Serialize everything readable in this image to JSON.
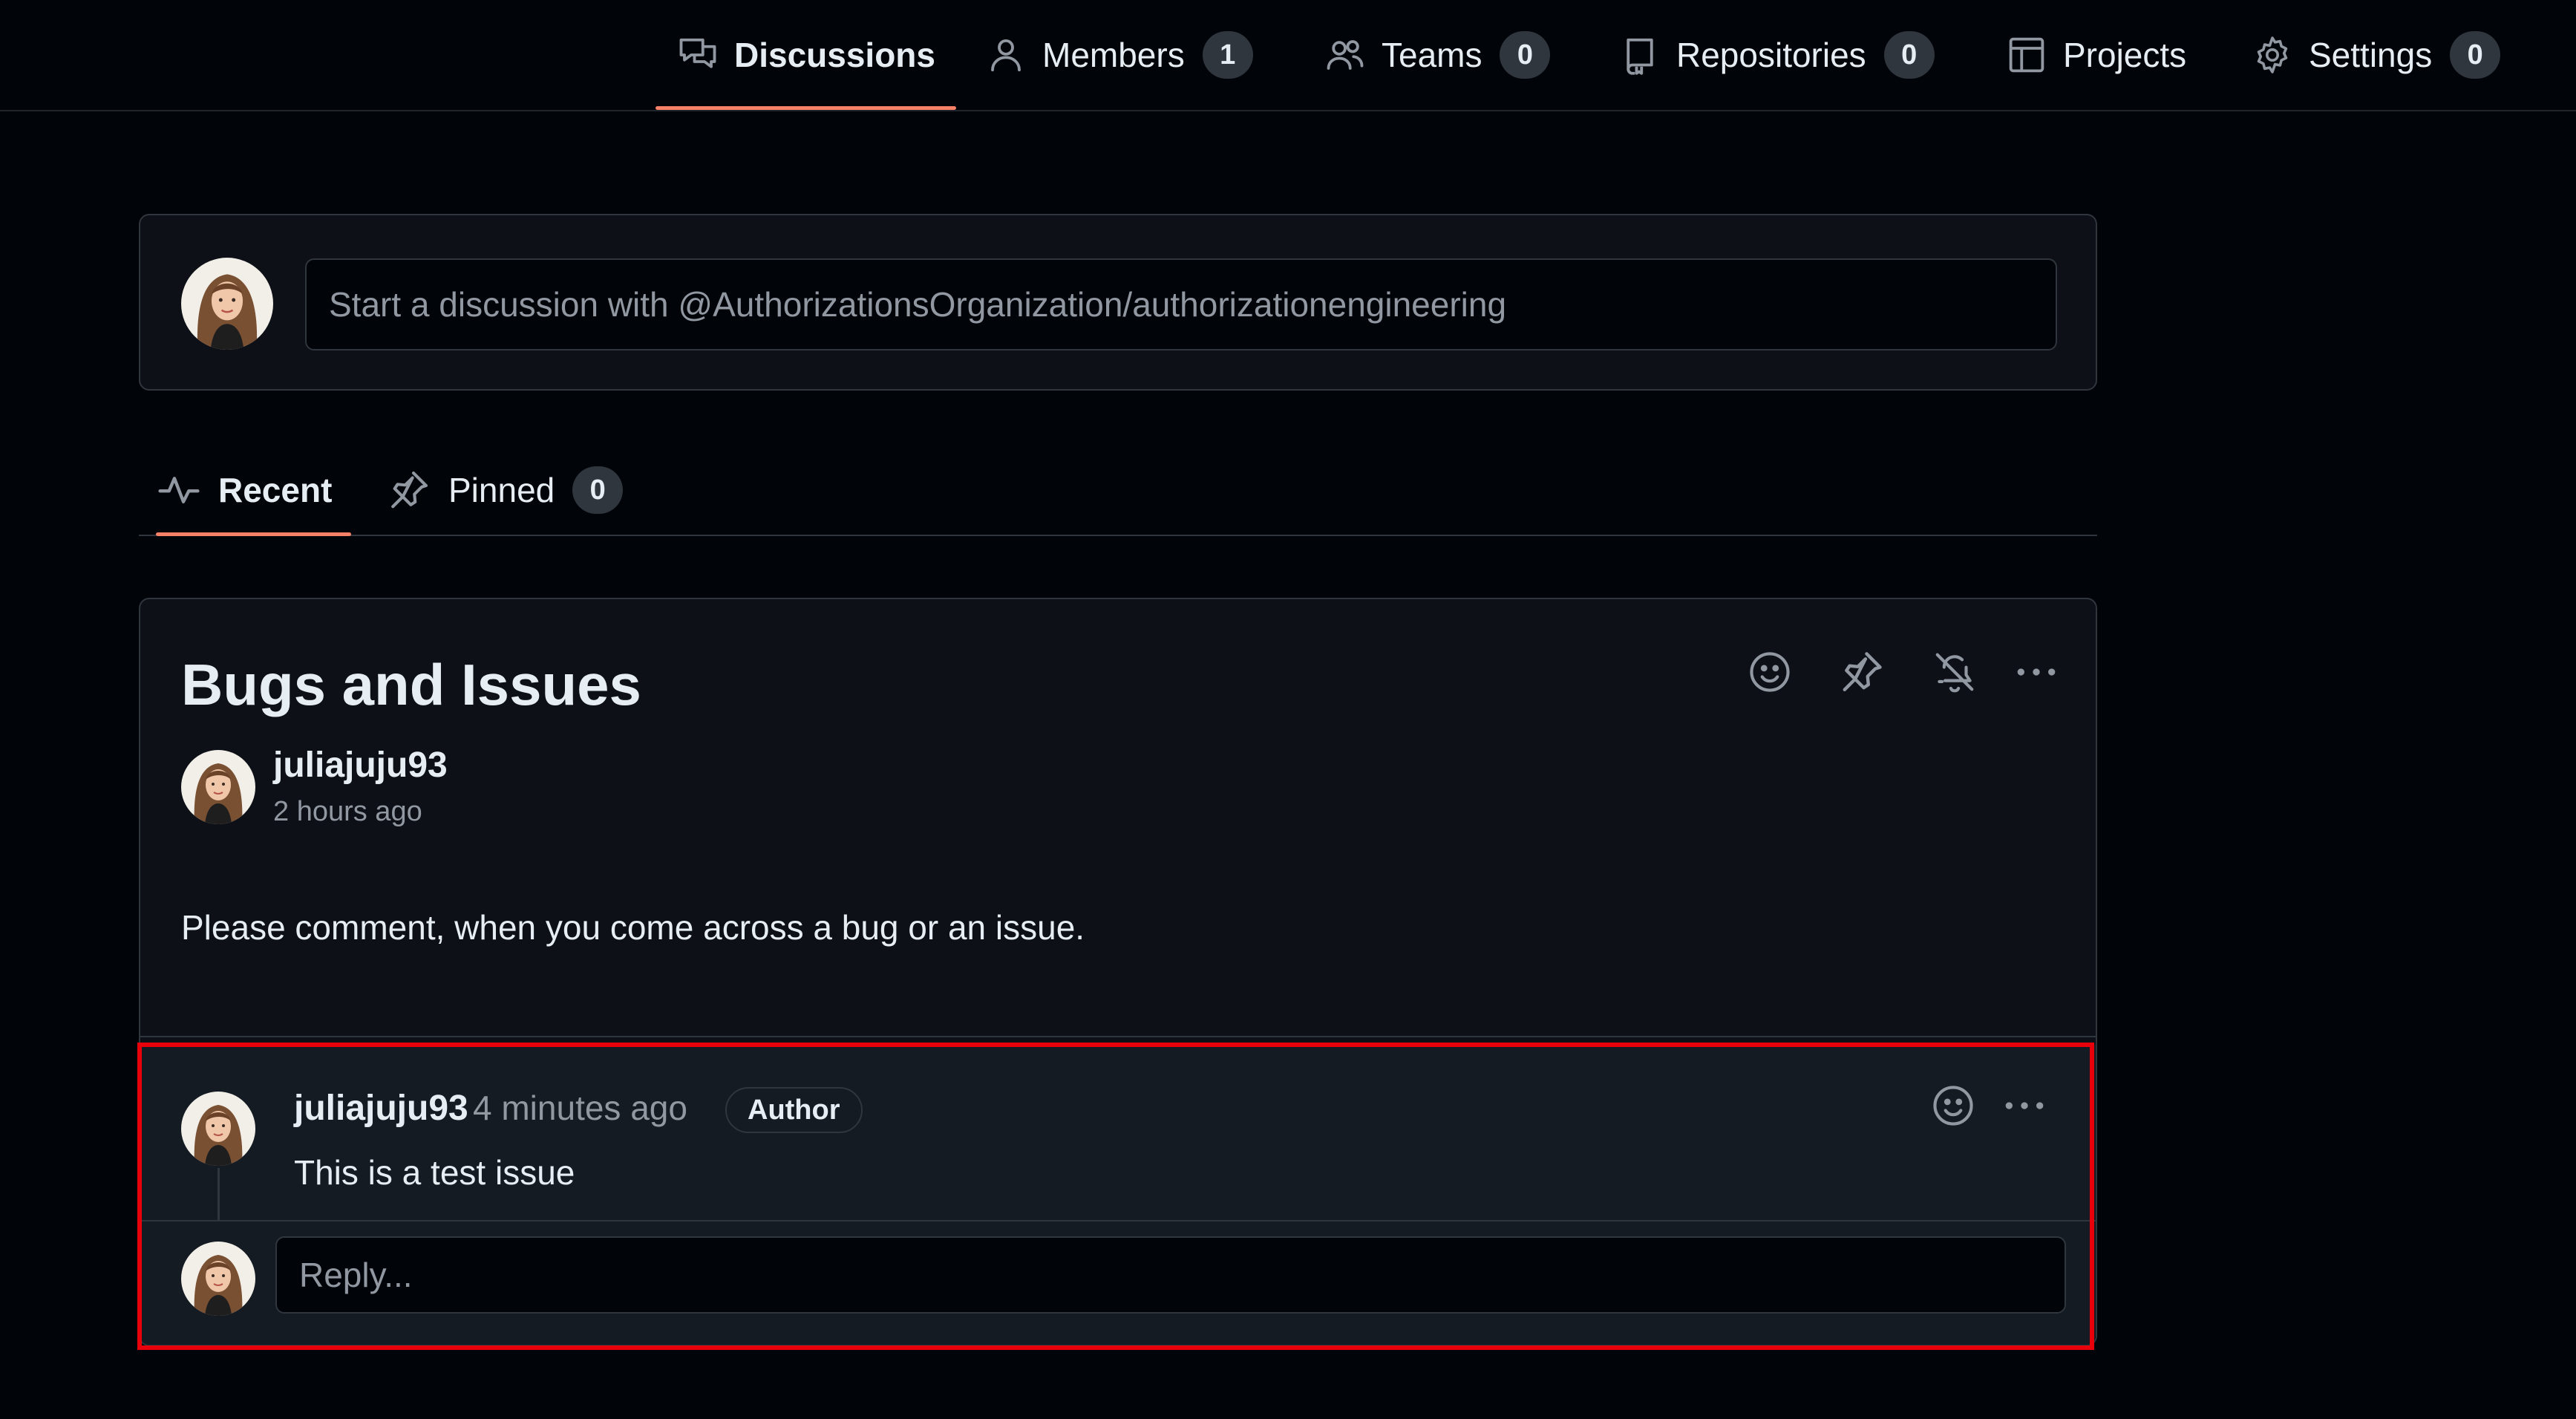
{
  "nav": {
    "tabs": [
      {
        "label": "Discussions",
        "icon": "discussions-icon",
        "selected": true
      },
      {
        "label": "Members",
        "icon": "person-icon",
        "count": "1"
      },
      {
        "label": "Teams",
        "icon": "people-icon",
        "count": "0"
      },
      {
        "label": "Repositories",
        "icon": "repo-icon",
        "count": "0"
      },
      {
        "label": "Projects",
        "icon": "table-icon"
      },
      {
        "label": "Settings",
        "icon": "gear-icon",
        "count": "0"
      }
    ]
  },
  "composer": {
    "placeholder": "Start a discussion with @AuthorizationsOrganization/authorizationengineering"
  },
  "subtabs": [
    {
      "label": "Recent",
      "icon": "pulse-icon",
      "selected": true
    },
    {
      "label": "Pinned",
      "icon": "pin-icon",
      "count": "0"
    }
  ],
  "discussion": {
    "title": "Bugs and Issues",
    "author": "juliajuju93",
    "time": "2 hours ago",
    "body": "Please comment, when you come across a bug or an issue.",
    "actions": [
      "smiley-icon",
      "pin-icon",
      "bell-slash-icon",
      "kebab-horizontal-icon"
    ]
  },
  "comment": {
    "author": "juliajuju93",
    "time": "4 minutes ago",
    "badge": "Author",
    "text": "This is a test issue",
    "actions": [
      "smiley-icon",
      "kebab-horizontal-icon"
    ]
  },
  "reply": {
    "placeholder": "Reply..."
  },
  "colors": {
    "background": "#010409",
    "card": "#0d1117",
    "border": "#30363d",
    "accent_underline": "#f78166",
    "highlight_box": "#e8000b"
  }
}
